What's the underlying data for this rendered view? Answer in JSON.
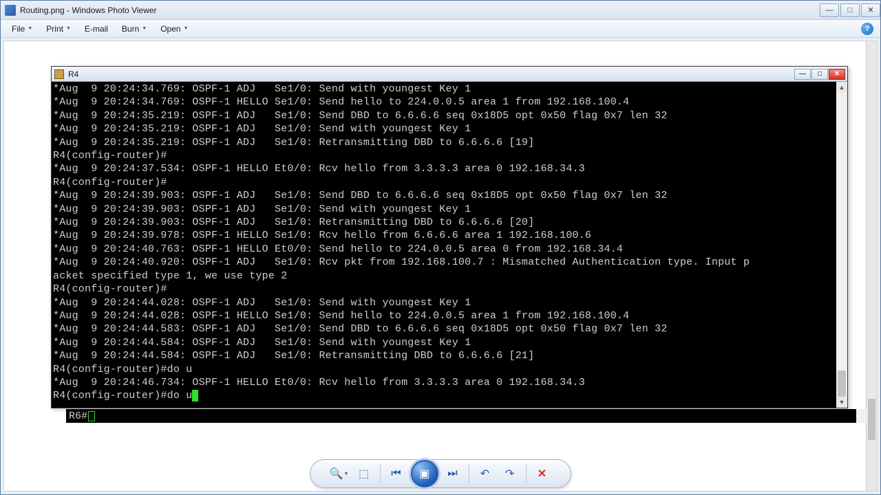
{
  "app_window": {
    "title": "Routing.png - Windows Photo Viewer"
  },
  "menu": {
    "file": "File",
    "print": "Print",
    "email": "E-mail",
    "burn": "Burn",
    "open": "Open"
  },
  "term_window": {
    "title": "R4"
  },
  "terminal_lines": [
    "*Aug  9 20:24:34.769: OSPF-1 ADJ   Se1/0: Send with youngest Key 1",
    "*Aug  9 20:24:34.769: OSPF-1 HELLO Se1/0: Send hello to 224.0.0.5 area 1 from 192.168.100.4",
    "*Aug  9 20:24:35.219: OSPF-1 ADJ   Se1/0: Send DBD to 6.6.6.6 seq 0x18D5 opt 0x50 flag 0x7 len 32",
    "*Aug  9 20:24:35.219: OSPF-1 ADJ   Se1/0: Send with youngest Key 1",
    "*Aug  9 20:24:35.219: OSPF-1 ADJ   Se1/0: Retransmitting DBD to 6.6.6.6 [19]",
    "R4(config-router)#",
    "*Aug  9 20:24:37.534: OSPF-1 HELLO Et0/0: Rcv hello from 3.3.3.3 area 0 192.168.34.3",
    "R4(config-router)#",
    "*Aug  9 20:24:39.903: OSPF-1 ADJ   Se1/0: Send DBD to 6.6.6.6 seq 0x18D5 opt 0x50 flag 0x7 len 32",
    "*Aug  9 20:24:39.903: OSPF-1 ADJ   Se1/0: Send with youngest Key 1",
    "*Aug  9 20:24:39.903: OSPF-1 ADJ   Se1/0: Retransmitting DBD to 6.6.6.6 [20]",
    "*Aug  9 20:24:39.978: OSPF-1 HELLO Se1/0: Rcv hello from 6.6.6.6 area 1 192.168.100.6",
    "*Aug  9 20:24:40.763: OSPF-1 HELLO Et0/0: Send hello to 224.0.0.5 area 0 from 192.168.34.4",
    "*Aug  9 20:24:40.920: OSPF-1 ADJ   Se1/0: Rcv pkt from 192.168.100.7 : Mismatched Authentication type. Input p",
    "acket specified type 1, we use type 2",
    "R4(config-router)#",
    "*Aug  9 20:24:44.028: OSPF-1 ADJ   Se1/0: Send with youngest Key 1",
    "*Aug  9 20:24:44.028: OSPF-1 HELLO Se1/0: Send hello to 224.0.0.5 area 1 from 192.168.100.4",
    "*Aug  9 20:24:44.583: OSPF-1 ADJ   Se1/0: Send DBD to 6.6.6.6 seq 0x18D5 opt 0x50 flag 0x7 len 32",
    "*Aug  9 20:24:44.584: OSPF-1 ADJ   Se1/0: Send with youngest Key 1",
    "*Aug  9 20:24:44.584: OSPF-1 ADJ   Se1/0: Retransmitting DBD to 6.6.6.6 [21]",
    "R4(config-router)#do u",
    "*Aug  9 20:24:46.734: OSPF-1 HELLO Et0/0: Rcv hello from 3.3.3.3 area 0 192.168.34.3",
    "R4(config-router)#do u"
  ],
  "r6_prompt": "R6#",
  "toolbar": {
    "zoom": "zoom",
    "fit": "fit",
    "prev": "previous",
    "play": "slideshow",
    "next": "next",
    "rotate_ccw": "rotate-left",
    "rotate_cw": "rotate-right",
    "delete": "delete"
  }
}
